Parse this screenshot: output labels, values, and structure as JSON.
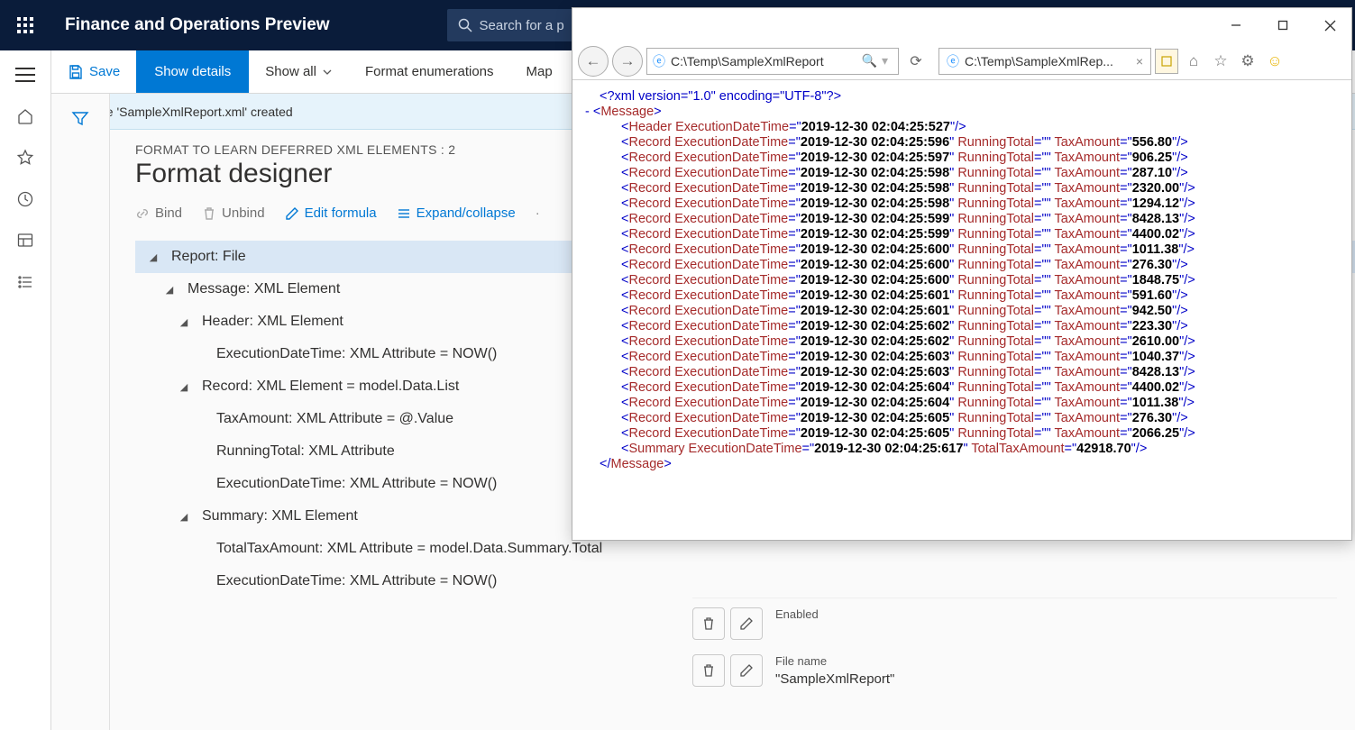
{
  "header": {
    "app_title": "Finance and Operations Preview",
    "search_placeholder": "Search for a p"
  },
  "actions": {
    "save": "Save",
    "show_details": "Show details",
    "show_all": "Show all",
    "format_enum": "Format enumerations",
    "map": "Map"
  },
  "info_message": "File 'SampleXmlReport.xml' created",
  "page": {
    "subtitle": "FORMAT TO LEARN DEFERRED XML ELEMENTS : 2",
    "title": "Format designer"
  },
  "format_toolbar": {
    "bind": "Bind",
    "unbind": "Unbind",
    "edit_formula": "Edit formula",
    "expand": "Expand/collapse"
  },
  "tree": [
    {
      "level": 0,
      "caret": true,
      "label": "Report: File",
      "sel": true
    },
    {
      "level": 1,
      "caret": true,
      "label": "Message: XML Element"
    },
    {
      "level": 2,
      "caret": true,
      "label": "Header: XML Element"
    },
    {
      "level": 3,
      "caret": false,
      "label": "ExecutionDateTime: XML Attribute = NOW()"
    },
    {
      "level": 2,
      "caret": true,
      "label": "Record: XML Element = model.Data.List"
    },
    {
      "level": 3,
      "caret": false,
      "label": "TaxAmount: XML Attribute = @.Value"
    },
    {
      "level": 3,
      "caret": false,
      "label": "RunningTotal: XML Attribute"
    },
    {
      "level": 3,
      "caret": false,
      "label": "ExecutionDateTime: XML Attribute = NOW()"
    },
    {
      "level": 2,
      "caret": true,
      "label": "Summary: XML Element"
    },
    {
      "level": 3,
      "caret": false,
      "label": "TotalTaxAmount: XML Attribute = model.Data.Summary.Total"
    },
    {
      "level": 3,
      "caret": false,
      "label": "ExecutionDateTime: XML Attribute = NOW()"
    }
  ],
  "properties": {
    "enabled_label": "Enabled",
    "filename_label": "File name",
    "filename_value": "\"SampleXmlReport\""
  },
  "ie": {
    "address": "C:\\Temp\\SampleXmlReport",
    "tab_title": "C:\\Temp\\SampleXmlRep...",
    "xml_decl": "<?xml version=\"1.0\" encoding=\"UTF-8\"?>",
    "root_open": "Message",
    "header": {
      "tag": "Header",
      "dt": "2019-12-30 02:04:25:527"
    },
    "records": [
      {
        "dt": "2019-12-30 02:04:25:596",
        "tax": "556.80"
      },
      {
        "dt": "2019-12-30 02:04:25:597",
        "tax": "906.25"
      },
      {
        "dt": "2019-12-30 02:04:25:598",
        "tax": "287.10"
      },
      {
        "dt": "2019-12-30 02:04:25:598",
        "tax": "2320.00"
      },
      {
        "dt": "2019-12-30 02:04:25:598",
        "tax": "1294.12"
      },
      {
        "dt": "2019-12-30 02:04:25:599",
        "tax": "8428.13"
      },
      {
        "dt": "2019-12-30 02:04:25:599",
        "tax": "4400.02"
      },
      {
        "dt": "2019-12-30 02:04:25:600",
        "tax": "1011.38"
      },
      {
        "dt": "2019-12-30 02:04:25:600",
        "tax": "276.30"
      },
      {
        "dt": "2019-12-30 02:04:25:600",
        "tax": "1848.75"
      },
      {
        "dt": "2019-12-30 02:04:25:601",
        "tax": "591.60"
      },
      {
        "dt": "2019-12-30 02:04:25:601",
        "tax": "942.50"
      },
      {
        "dt": "2019-12-30 02:04:25:602",
        "tax": "223.30"
      },
      {
        "dt": "2019-12-30 02:04:25:602",
        "tax": "2610.00"
      },
      {
        "dt": "2019-12-30 02:04:25:603",
        "tax": "1040.37"
      },
      {
        "dt": "2019-12-30 02:04:25:603",
        "tax": "8428.13"
      },
      {
        "dt": "2019-12-30 02:04:25:604",
        "tax": "4400.02"
      },
      {
        "dt": "2019-12-30 02:04:25:604",
        "tax": "1011.38"
      },
      {
        "dt": "2019-12-30 02:04:25:605",
        "tax": "276.30"
      },
      {
        "dt": "2019-12-30 02:04:25:605",
        "tax": "2066.25"
      }
    ],
    "summary": {
      "dt": "2019-12-30 02:04:25:617",
      "total": "42918.70"
    }
  }
}
